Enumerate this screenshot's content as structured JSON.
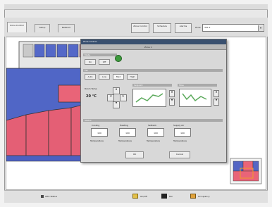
{
  "window": {
    "title": ""
  },
  "toolbar": {
    "tabs": [
      {
        "label": "Zone Control"
      },
      {
        "label": "Setup"
      },
      {
        "label": "Network"
      }
    ],
    "buttons": [
      {
        "label": "Zone Control"
      },
      {
        "label": "Schedule"
      },
      {
        "label": "Alarms"
      }
    ],
    "field_label": "Zone",
    "field_value": "301-1"
  },
  "dialog": {
    "title": "Zone Control",
    "header": "Zone 1",
    "mode": {
      "header": "Mode",
      "buttons": [
        "On",
        "Off"
      ]
    },
    "fan": {
      "header": "Fan",
      "buttons": [
        "Auto",
        "Low",
        "Med",
        "High"
      ]
    },
    "room": {
      "label": "Room Temp",
      "value": "20 °C"
    },
    "setpoint_header": "Setpoint",
    "flow_header": "Flow",
    "table": {
      "header": "Status",
      "columns": [
        {
          "name": "Cooling",
          "value": "100",
          "unit": "Temperature"
        },
        {
          "name": "Heating",
          "value": "100",
          "unit": "Temperature"
        },
        {
          "name": "Setback",
          "value": "100",
          "unit": "Temperature"
        },
        {
          "name": "Supply Air",
          "value": "100",
          "unit": "Temperature"
        }
      ]
    },
    "ok": "OK",
    "cancel": "Cancel"
  },
  "statusbar": {
    "left": "",
    "items": [
      {
        "label": "AHU Status"
      },
      {
        "label": "On/Off"
      },
      {
        "label": "Fan"
      },
      {
        "label": "Occupancy"
      }
    ]
  }
}
